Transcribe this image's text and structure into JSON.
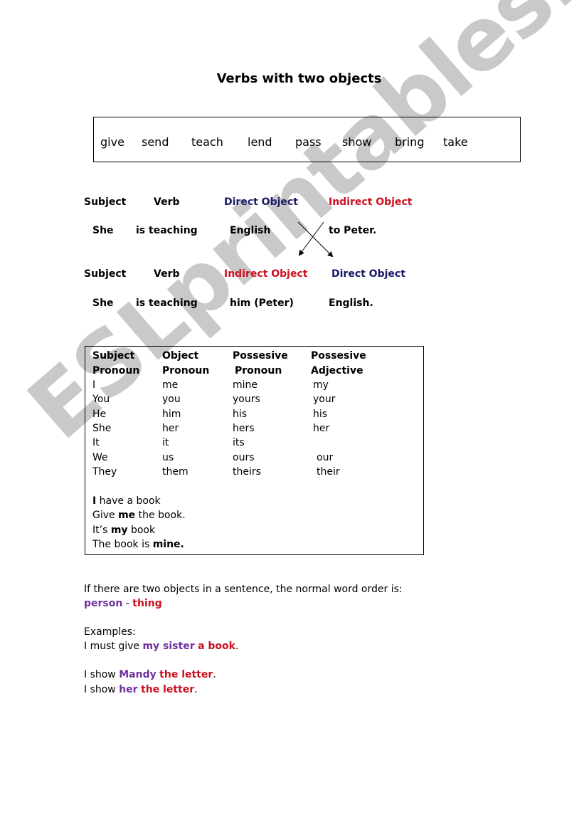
{
  "title": "Verbs with two objects",
  "verbs": [
    "give",
    "send",
    "teach",
    "lend",
    "pass",
    "show",
    "bring",
    "take"
  ],
  "pattern1": {
    "labels": {
      "subject": "Subject",
      "verb": "Verb",
      "direct": "Direct Object",
      "indirect": "Indirect Object"
    },
    "example": {
      "subject": "She",
      "verb": "is teaching",
      "direct": "English",
      "indirect": "to Peter."
    }
  },
  "pattern2": {
    "labels": {
      "subject": "Subject",
      "verb": "Verb",
      "indirect": "Indirect Object",
      "direct": "Direct Object"
    },
    "example": {
      "subject": "She",
      "verb": "is teaching",
      "indirect": "him (Peter)",
      "direct": "English."
    }
  },
  "pronoun_table": {
    "headers": [
      [
        "Subject",
        "Pronoun"
      ],
      [
        "Object",
        "Pronoun"
      ],
      [
        "Possesive",
        "Pronoun"
      ],
      [
        "Possesive",
        "Adjective"
      ]
    ],
    "rows": [
      [
        "I",
        "me",
        "mine",
        "my"
      ],
      [
        "You",
        "you",
        "yours",
        "your"
      ],
      [
        "He",
        "him",
        "his",
        "his"
      ],
      [
        "She",
        "her",
        "hers",
        "her"
      ],
      [
        "It",
        "it",
        "its",
        ""
      ],
      [
        "We",
        "us",
        "ours",
        "our"
      ],
      [
        "They",
        "them",
        "theirs",
        "their"
      ]
    ],
    "examples": [
      {
        "bold": "I",
        "after": " have a book",
        "before": ""
      },
      {
        "before": "Give ",
        "bold": "me",
        "after": " the book."
      },
      {
        "before": "It’s ",
        "bold": "my",
        "after": " book"
      },
      {
        "before": "The book is ",
        "bold": "mine.",
        "after": ""
      }
    ]
  },
  "rule": {
    "text": "If there are two objects in a sentence, the normal word order is:",
    "person": "person",
    "separator": " - ",
    "thing": "thing"
  },
  "examples": {
    "heading": "Examples:",
    "sentences": [
      {
        "before": "I must give ",
        "person": "my sister",
        "thing": "a book",
        "after": "."
      },
      {
        "before": "I show ",
        "person": "Mandy",
        "thing": "the letter",
        "after": "."
      },
      {
        "before": "I show ",
        "person": "her",
        "thing": "the letter",
        "after": "."
      }
    ]
  },
  "watermark": "ESLprintables.com",
  "colors": {
    "direct_object": "#1a1a66",
    "indirect_object": "#cc1020",
    "person": "#7030a0",
    "thing": "#cc1020",
    "watermark": "#c4c4c4"
  }
}
